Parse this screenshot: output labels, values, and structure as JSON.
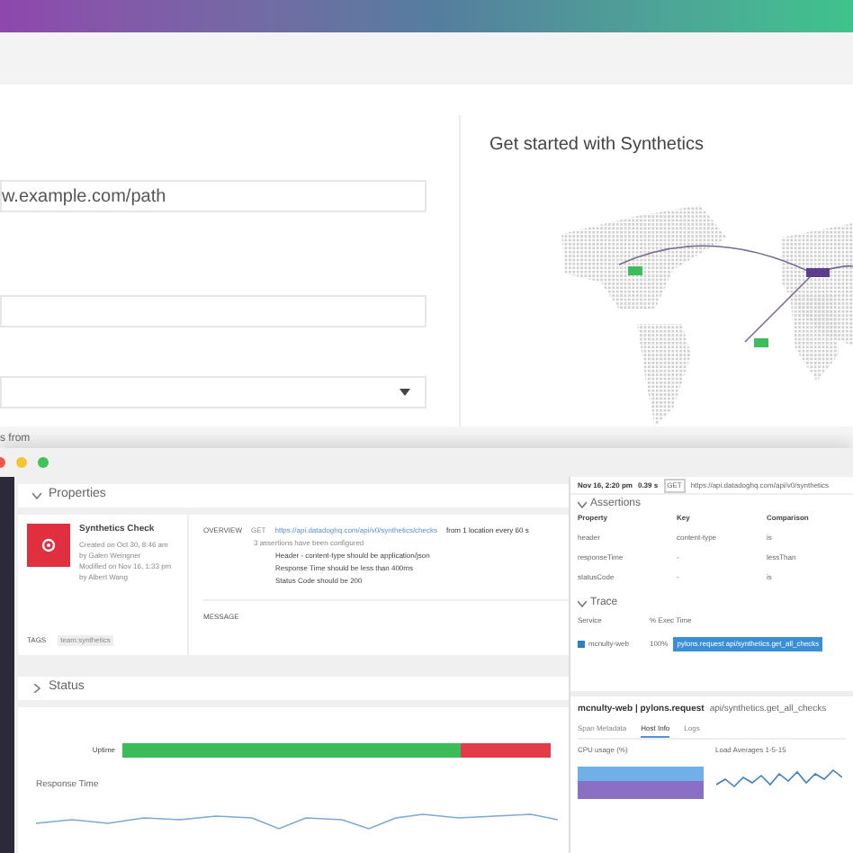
{
  "form": {
    "url_field": {
      "value": "w.example.com/path"
    },
    "cut_label": "s from"
  },
  "promo": {
    "title": "Get started with Synthetics"
  },
  "window": {
    "sections": [
      {
        "title": "Properties",
        "expanded": true
      },
      {
        "title": "Status",
        "expanded": false
      }
    ],
    "check": {
      "name": "Synthetics Check",
      "meta": [
        "Created on Oct 30, 8:46 am",
        "by Galen Weingner",
        "Modified on Nov 16, 1:33 pm",
        "by Albert Wang"
      ],
      "tags_label": "TAGS",
      "tags": [
        "team:synthetics"
      ],
      "overview_label": "OVERVIEW",
      "method": "GET",
      "url": "https://api.datadoghq.com/api/v0/synthetics/checks",
      "schedule": "from 1 location every 60 s",
      "summary": "3 assertions have been configured",
      "assertions": [
        "Header - content-type should be application/json",
        "Response Time should be less than 400ms",
        "Status Code should be 200"
      ],
      "message_label": "MESSAGE"
    },
    "uptime_label": "Uptime",
    "uptime": {
      "level": 0.79
    },
    "response_time_label": "Response Time"
  },
  "detail": {
    "time": "Nov 16, 2:20 pm",
    "duration": "0.39 s",
    "method": "GET",
    "url": "https://api.datadoghq.com/api/v0/synthetics",
    "assertions_title": "Assertions",
    "columns": [
      "Property",
      "Key",
      "Comparison"
    ],
    "rows": [
      [
        "header",
        "content-type",
        "is"
      ],
      [
        "responseTime",
        "-",
        "lessThan"
      ],
      [
        "statusCode",
        "-",
        "is"
      ]
    ],
    "trace_title": "Trace",
    "trace_columns": [
      "Service",
      "% Exec Time"
    ],
    "service": {
      "name": "mcnulty-web",
      "share": "100%",
      "color": "#2f7fc1"
    },
    "span_bar": "pylons.request api/synthetics.get_all_checks",
    "span": {
      "title": "mcnulty-web | pylons.request",
      "resource": "api/synthetics.get_all_checks"
    },
    "tabs": [
      {
        "label": "Span Metadata",
        "selected": false
      },
      {
        "label": "Host Info",
        "selected": true
      },
      {
        "label": "Logs",
        "selected": false
      }
    ],
    "charts": [
      "CPU usage (%)",
      "Load Averages 1-5-15"
    ]
  }
}
